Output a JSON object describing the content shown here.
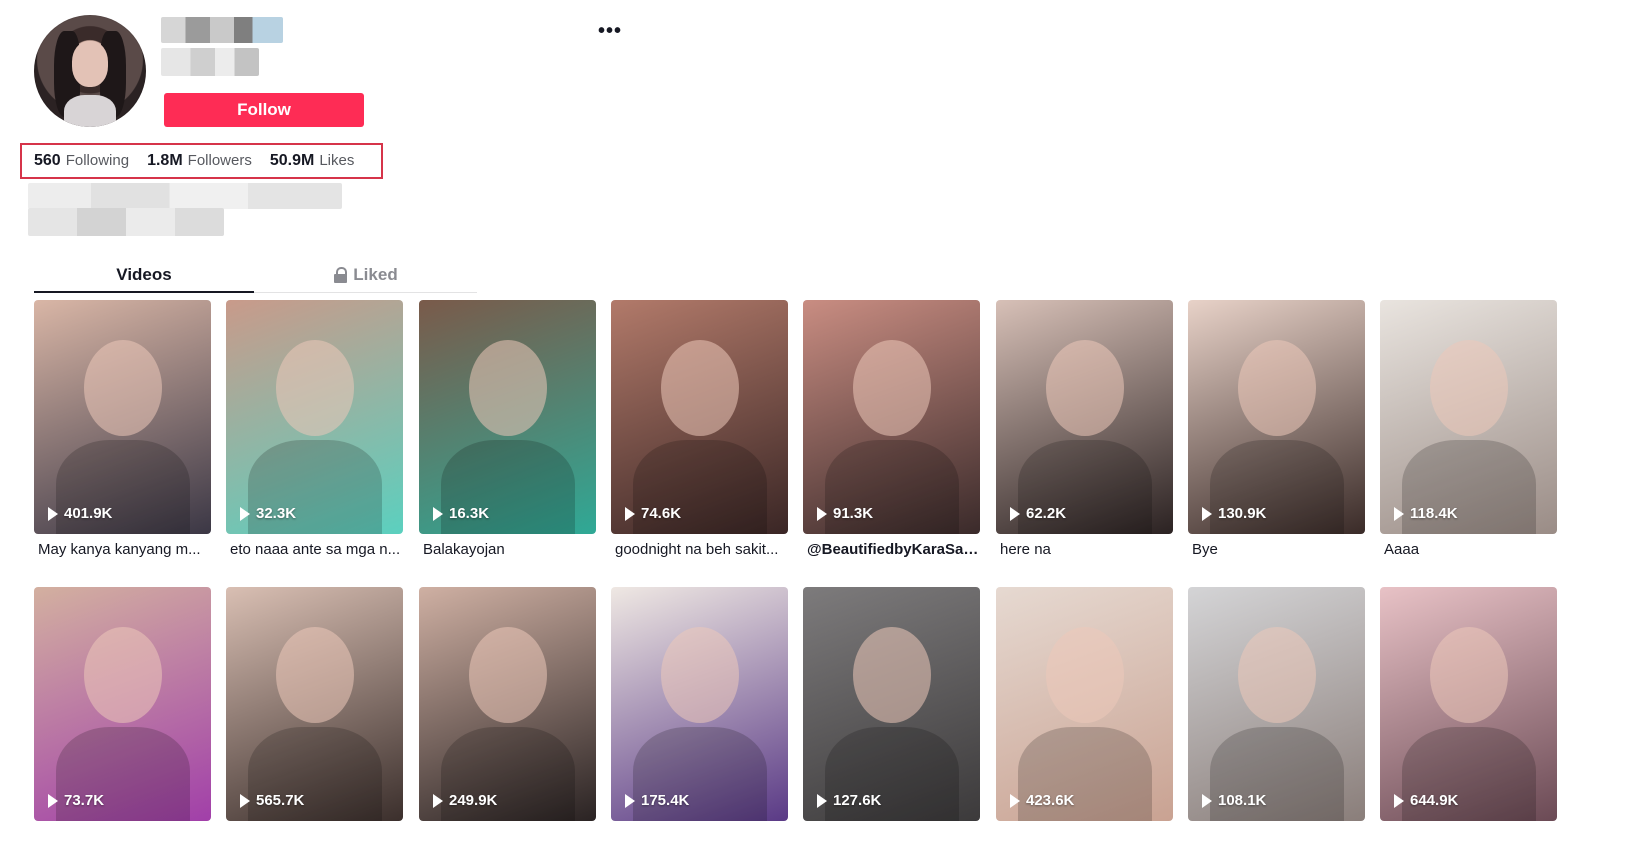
{
  "profile": {
    "follow_label": "Follow",
    "more_label": "•••",
    "stats": [
      {
        "value": "560",
        "label": "Following"
      },
      {
        "value": "1.8M",
        "label": "Followers"
      },
      {
        "value": "50.9M",
        "label": "Likes"
      }
    ]
  },
  "tabs": {
    "videos": "Videos",
    "liked": "Liked"
  },
  "videos": [
    {
      "views": "401.9K",
      "caption": "May kanya kanyang m...",
      "colors": [
        "#d9b6a6",
        "#3b3745"
      ]
    },
    {
      "views": "32.3K",
      "caption": "eto naaa ante sa mga n...",
      "colors": [
        "#c99a8a",
        "#5bd0bf"
      ]
    },
    {
      "views": "16.3K",
      "caption": "Balakayojan",
      "colors": [
        "#7a5a4a",
        "#2fa996"
      ]
    },
    {
      "views": "74.6K",
      "caption": "goodnight na beh sakit...",
      "colors": [
        "#b27a6a",
        "#3a2625"
      ]
    },
    {
      "views": "91.3K",
      "caption": "@BeautifiedbyKaraSams",
      "colors": [
        "#c98d82",
        "#3a2a2a"
      ]
    },
    {
      "views": "62.2K",
      "caption": "here na",
      "colors": [
        "#d7c0b7",
        "#2b2222"
      ]
    },
    {
      "views": "130.9K",
      "caption": "Bye",
      "colors": [
        "#e8d2c8",
        "#3a2b28"
      ]
    },
    {
      "views": "118.4K",
      "caption": "Aaaa",
      "colors": [
        "#e9e4df",
        "#9a8c86"
      ]
    },
    {
      "views": "73.7K",
      "caption": "",
      "colors": [
        "#d3b0a0",
        "#a13fa9"
      ]
    },
    {
      "views": "565.7K",
      "caption": "",
      "colors": [
        "#d9bfb3",
        "#3b2f2c"
      ]
    },
    {
      "views": "249.9K",
      "caption": "",
      "colors": [
        "#cfb0a3",
        "#2a2323"
      ]
    },
    {
      "views": "175.4K",
      "caption": "",
      "colors": [
        "#efe8e3",
        "#5a3a86"
      ]
    },
    {
      "views": "127.6K",
      "caption": "",
      "colors": [
        "#7d7b7c",
        "#3c3a3b"
      ]
    },
    {
      "views": "423.6K",
      "caption": "",
      "colors": [
        "#e6d9d1",
        "#c9a292"
      ]
    },
    {
      "views": "108.1K",
      "caption": "",
      "colors": [
        "#d4d4d6",
        "#8a7e7a"
      ]
    },
    {
      "views": "644.9K",
      "caption": "",
      "colors": [
        "#e8c2c6",
        "#6b4a55"
      ]
    }
  ]
}
